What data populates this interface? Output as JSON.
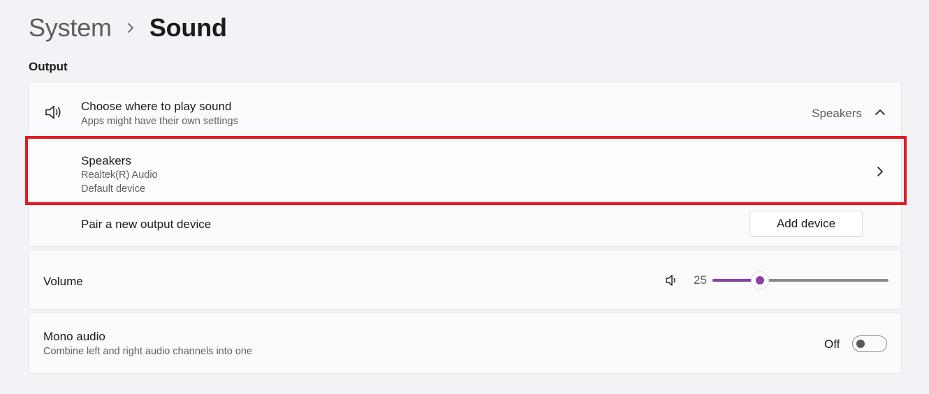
{
  "breadcrumb": {
    "parent": "System",
    "current": "Sound"
  },
  "output": {
    "section_title": "Output",
    "choose": {
      "title": "Choose where to play sound",
      "subtitle": "Apps might have their own settings",
      "value": "Speakers",
      "icon": "speaker-icon",
      "expanded": true
    },
    "device": {
      "name": "Speakers",
      "driver": "Realtek(R) Audio",
      "status": "Default device",
      "icon": "chevron-right-icon"
    },
    "pair": {
      "title": "Pair a new output device",
      "button_label": "Add device"
    }
  },
  "volume": {
    "title": "Volume",
    "value": "25",
    "level": 0.27,
    "accent_color": "#8c3fa7"
  },
  "mono": {
    "title": "Mono audio",
    "subtitle": "Combine left and right audio channels into one",
    "state_label": "Off",
    "enabled": false
  },
  "highlight_color": "#e11b22"
}
